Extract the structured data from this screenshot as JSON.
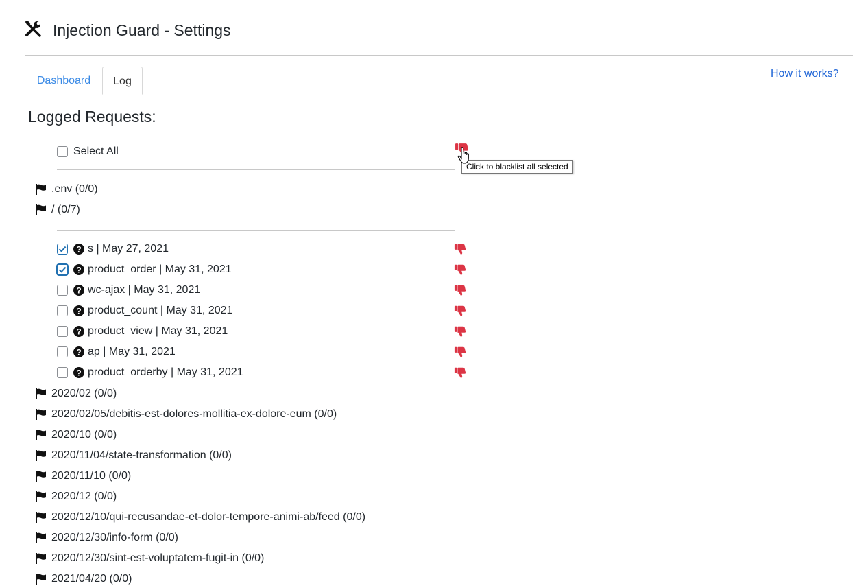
{
  "header": {
    "title": "Injection Guard - Settings",
    "icon": "wrench-screwdriver-icon"
  },
  "tabs": [
    {
      "label": "Dashboard",
      "active": false
    },
    {
      "label": "Log",
      "active": true
    }
  ],
  "help_link": "How it works?",
  "section_title": "Logged Requests:",
  "select_all": {
    "label": "Select All",
    "checked": false
  },
  "tooltip": "Click to blacklist all selected",
  "colors": {
    "accent": "#dc3545",
    "link": "#1e64d6",
    "tab_link": "#3a8ae6",
    "checkbox": "#2271b1"
  },
  "folders_top": [
    {
      "label": ".env (0/0)"
    },
    {
      "label": "/ (0/7)"
    }
  ],
  "requests": [
    {
      "label": "s | May 27, 2021",
      "checked": true
    },
    {
      "label": "product_order | May 31, 2021",
      "checked": true
    },
    {
      "label": "wc-ajax | May 31, 2021",
      "checked": false
    },
    {
      "label": "product_count | May 31, 2021",
      "checked": false
    },
    {
      "label": "product_view | May 31, 2021",
      "checked": false
    },
    {
      "label": "ap | May 31, 2021",
      "checked": false
    },
    {
      "label": "product_orderby | May 31, 2021",
      "checked": false
    }
  ],
  "folders_bottom": [
    {
      "label": "2020/02 (0/0)"
    },
    {
      "label": "2020/02/05/debitis-est-dolores-mollitia-ex-dolore-eum (0/0)"
    },
    {
      "label": "2020/10 (0/0)"
    },
    {
      "label": "2020/11/04/state-transformation (0/0)"
    },
    {
      "label": "2020/11/10 (0/0)"
    },
    {
      "label": "2020/12 (0/0)"
    },
    {
      "label": "2020/12/10/qui-recusandae-et-dolor-tempore-animi-ab/feed (0/0)"
    },
    {
      "label": "2020/12/30/info-form (0/0)"
    },
    {
      "label": "2020/12/30/sint-est-voluptatem-fugit-in (0/0)"
    },
    {
      "label": "2021/04/20 (0/0)"
    }
  ]
}
